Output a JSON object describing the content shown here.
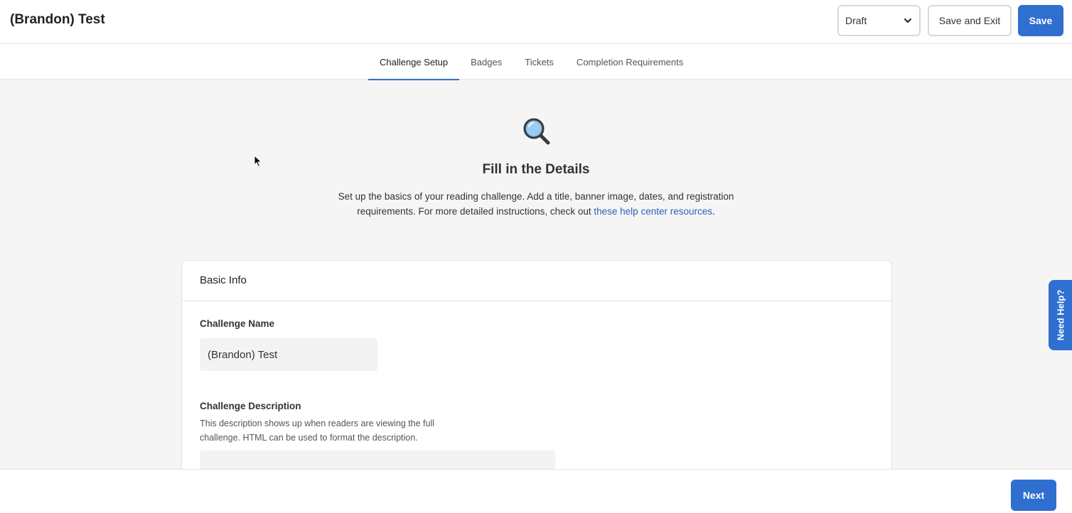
{
  "header": {
    "title": "(Brandon) Test",
    "status_value": "Draft",
    "save_exit_label": "Save and Exit",
    "save_label": "Save"
  },
  "tabs": [
    {
      "label": "Challenge Setup",
      "active": true
    },
    {
      "label": "Badges",
      "active": false
    },
    {
      "label": "Tickets",
      "active": false
    },
    {
      "label": "Completion Requirements",
      "active": false
    }
  ],
  "hero": {
    "icon": "magnifying-glass-icon",
    "heading": "Fill in the Details",
    "text_before_link": "Set up the basics of your reading challenge. Add a title, banner image, dates, and registration requirements. For more detailed instructions, check out ",
    "link_text": "these help center resources",
    "text_after_link": "."
  },
  "basic_info": {
    "title": "Basic Info",
    "name_label": "Challenge Name",
    "name_value": "(Brandon) Test",
    "description_label": "Challenge Description",
    "description_help": "This description shows up when readers are viewing the full challenge. HTML can be used to format the description."
  },
  "footer": {
    "next_label": "Next"
  },
  "help_tab": {
    "label": "Need Help?"
  },
  "colors": {
    "primary": "#2f6fcf",
    "link": "#2a64b8",
    "background": "#f5f5f5"
  }
}
